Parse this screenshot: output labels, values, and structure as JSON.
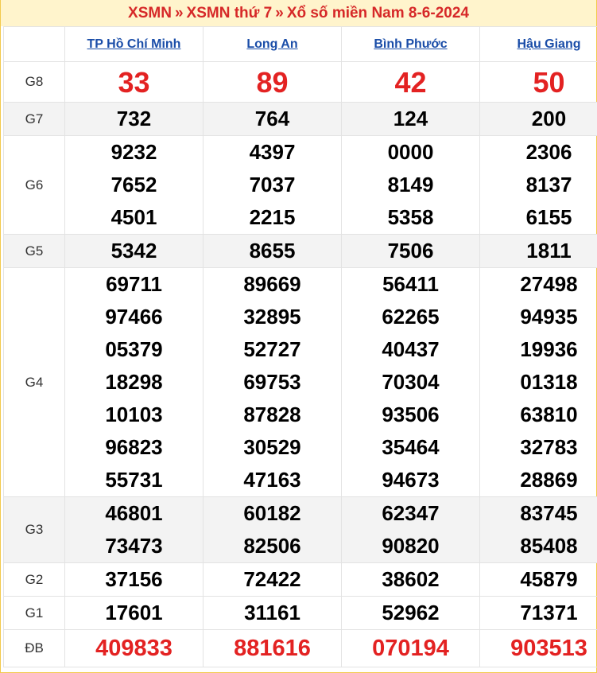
{
  "breadcrumb": {
    "link1": "XSMN",
    "sep": "»",
    "link2": "XSMN thứ 7",
    "link3": "Xổ số miền Nam 8-6-2024"
  },
  "provinces": [
    "TP Hồ Chí Minh",
    "Long An",
    "Bình Phước",
    "Hậu Giang"
  ],
  "prizes": {
    "g8": {
      "label": "G8",
      "values": [
        [
          "33"
        ],
        [
          "89"
        ],
        [
          "42"
        ],
        [
          "50"
        ]
      ]
    },
    "g7": {
      "label": "G7",
      "values": [
        [
          "732"
        ],
        [
          "764"
        ],
        [
          "124"
        ],
        [
          "200"
        ]
      ]
    },
    "g6": {
      "label": "G6",
      "values": [
        [
          "9232",
          "7652",
          "4501"
        ],
        [
          "4397",
          "7037",
          "2215"
        ],
        [
          "0000",
          "8149",
          "5358"
        ],
        [
          "2306",
          "8137",
          "6155"
        ]
      ]
    },
    "g5": {
      "label": "G5",
      "values": [
        [
          "5342"
        ],
        [
          "8655"
        ],
        [
          "7506"
        ],
        [
          "1811"
        ]
      ]
    },
    "g4": {
      "label": "G4",
      "values": [
        [
          "69711",
          "97466",
          "05379",
          "18298",
          "10103",
          "96823",
          "55731"
        ],
        [
          "89669",
          "32895",
          "52727",
          "69753",
          "87828",
          "30529",
          "47163"
        ],
        [
          "56411",
          "62265",
          "40437",
          "70304",
          "93506",
          "35464",
          "94673"
        ],
        [
          "27498",
          "94935",
          "19936",
          "01318",
          "63810",
          "32783",
          "28869"
        ]
      ]
    },
    "g3": {
      "label": "G3",
      "values": [
        [
          "46801",
          "73473"
        ],
        [
          "60182",
          "82506"
        ],
        [
          "62347",
          "90820"
        ],
        [
          "83745",
          "85408"
        ]
      ]
    },
    "g2": {
      "label": "G2",
      "values": [
        [
          "37156"
        ],
        [
          "72422"
        ],
        [
          "38602"
        ],
        [
          "45879"
        ]
      ]
    },
    "g1": {
      "label": "G1",
      "values": [
        [
          "17601"
        ],
        [
          "31161"
        ],
        [
          "52962"
        ],
        [
          "71371"
        ]
      ]
    },
    "db": {
      "label": "ĐB",
      "values": [
        [
          "409833"
        ],
        [
          "881616"
        ],
        [
          "070194"
        ],
        [
          "903513"
        ]
      ]
    }
  }
}
